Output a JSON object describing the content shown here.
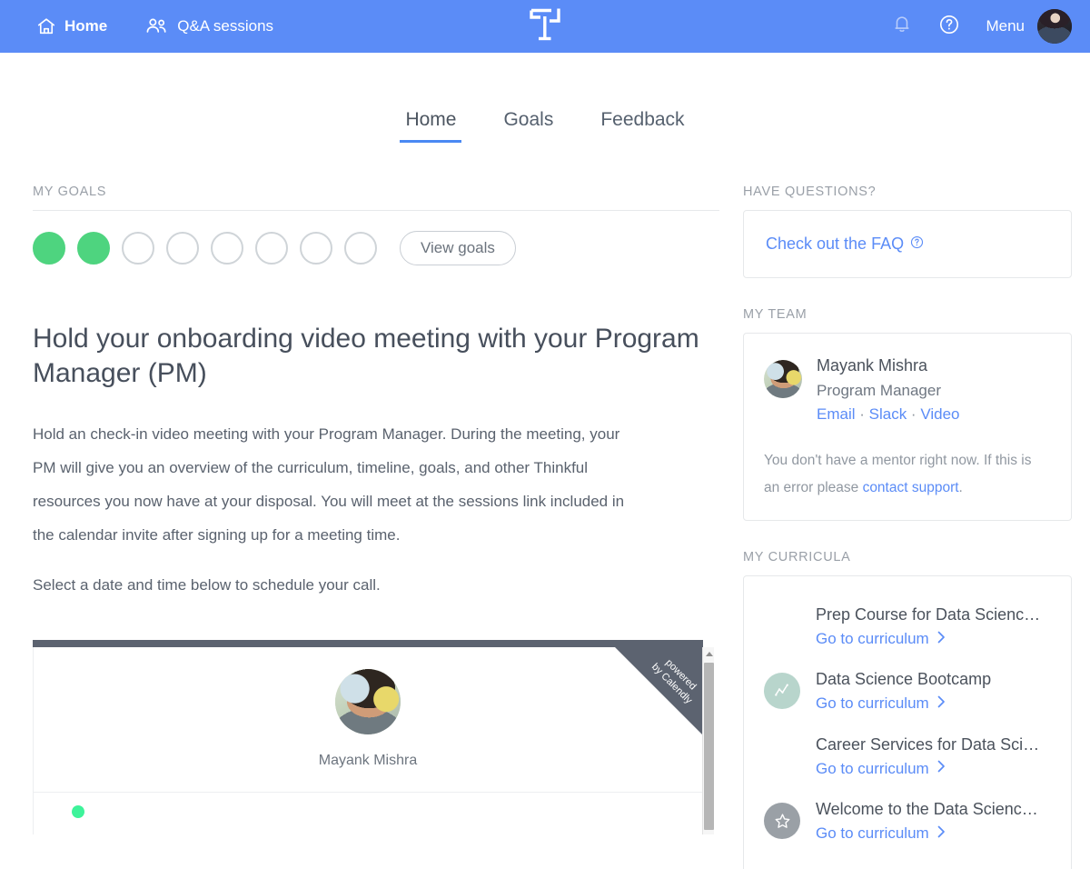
{
  "topnav": {
    "home_label": "Home",
    "qa_label": "Q&A sessions",
    "menu_label": "Menu",
    "brand": "Thinkful",
    "icons": {
      "home": "home-icon",
      "qa": "people-icon",
      "logo": "thinkful-logo",
      "bell": "bell-icon",
      "help": "question-circle-icon",
      "avatar": "user-avatar"
    },
    "accent_color": "#5b8cf7"
  },
  "tabs": [
    {
      "label": "Home",
      "active": true
    },
    {
      "label": "Goals",
      "active": false
    },
    {
      "label": "Feedback",
      "active": false
    }
  ],
  "goals": {
    "section_label": "MY GOALS",
    "total": 8,
    "completed": 2,
    "completed_color": "#4ed47f",
    "view_goals_label": "View goals"
  },
  "task": {
    "title": "Hold your onboarding video meeting with your Program Manager (PM)",
    "paragraphs": [
      "Hold an check-in video meeting with your Program Manager. During the meeting, your PM will give you an overview of the curriculum, timeline, goals, and other Thinkful resources you now have at your disposal. You will meet at the sessions link included in the calendar invite after signing up for a meeting time.",
      "Select a date and time below to schedule your call."
    ]
  },
  "calendly": {
    "ribbon_line1": "powered",
    "ribbon_line2": "by Calendly",
    "host_name": "Mayank Mishra"
  },
  "sidebar": {
    "faq": {
      "section_label": "HAVE QUESTIONS?",
      "link_label": "Check out the FAQ"
    },
    "team": {
      "section_label": "MY TEAM",
      "member_name": "Mayank Mishra",
      "member_role": "Program Manager",
      "link_email": "Email",
      "link_slack": "Slack",
      "link_video": "Video",
      "separator": " · ",
      "note_before": "You don't have a mentor right now. If this is an error please ",
      "note_link": "contact support",
      "note_after": "."
    },
    "curricula": {
      "section_label": "MY CURRICULA",
      "go_label": "Go to curriculum",
      "items": [
        {
          "title": "Prep Course for Data Science…",
          "icon": "none"
        },
        {
          "title": "Data Science Bootcamp",
          "icon": "chart-line-icon"
        },
        {
          "title": "Career Services for Data Scie…",
          "icon": "none"
        },
        {
          "title": "Welcome to the Data Science…",
          "icon": "star-icon"
        }
      ]
    }
  }
}
